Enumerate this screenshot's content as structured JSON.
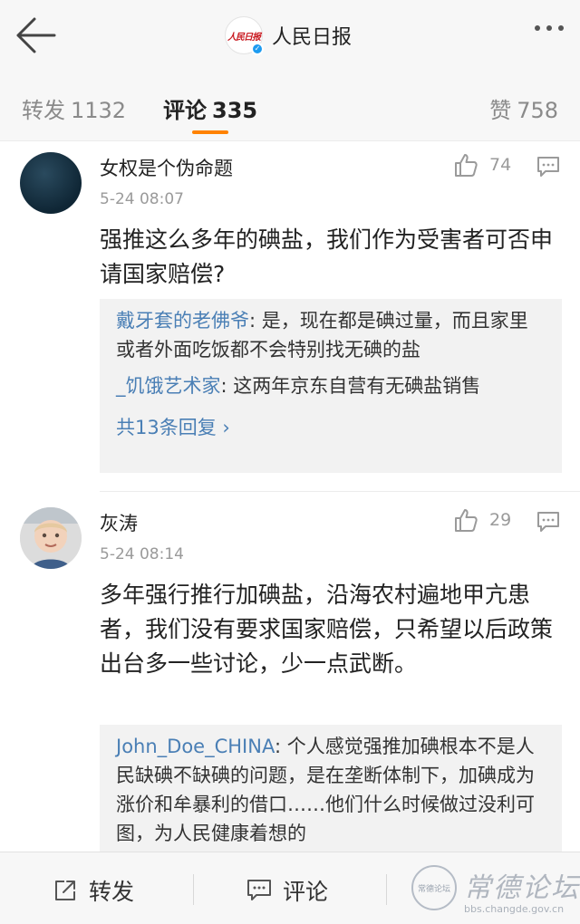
{
  "header": {
    "account_name": "人民日报",
    "logo_text": "人民日报",
    "verified_mark": "✓"
  },
  "tabs": {
    "repost_label": "转发",
    "repost_count": "1132",
    "comment_label": "评论",
    "comment_count": "335",
    "like_label": "赞",
    "like_count": "758"
  },
  "comments": [
    {
      "username": "女权是个伪命题",
      "time": "5-24 08:07",
      "likes": "74",
      "text": "强推这么多年的碘盐，我们作为受害者可否申请国家赔偿?",
      "replies": [
        {
          "user": "戴牙套的老佛爷",
          "text": ": 是，现在都是碘过量，而且家里或者外面吃饭都不会特别找无碘的盐"
        },
        {
          "user": "_饥饿艺术家",
          "text": ": 这两年京东自营有无碘盐销售"
        }
      ],
      "reply_count_label": "共13条回复 ›"
    },
    {
      "username": "灰涛",
      "time": "5-24 08:14",
      "likes": "29",
      "text": "多年强行推行加碘盐，沿海农村遍地甲亢患者，我们没有要求国家赔偿，只希望以后政策出台多一些讨论，少一点武断。",
      "replies": [
        {
          "user": "John_Doe_CHINA",
          "text": ": 个人感觉强推加碘根本不是人民缺碘不缺碘的问题，是在垄断体制下，加碘成为涨价和牟暴利的借口……他们什么时候做过没利可图，为人民健康着想的"
        }
      ]
    }
  ],
  "bottom_bar": {
    "repost_label": "转发",
    "comment_label": "评论"
  },
  "watermark": {
    "title": "常德论坛",
    "url": "bbs.changde.gov.cn",
    "seal_text": "常德论坛"
  },
  "icons": {
    "back": "arrow-left-icon",
    "more": "more-dots-icon",
    "like": "thumbs-up-icon",
    "reply": "comment-bubble-icon",
    "share": "share-icon"
  },
  "colors": {
    "accent": "#ff8200",
    "link": "#4a7fb5",
    "header_bg": "#f7f7f7",
    "reply_bg": "#f2f2f2",
    "meta_text": "#9a9a9a"
  }
}
